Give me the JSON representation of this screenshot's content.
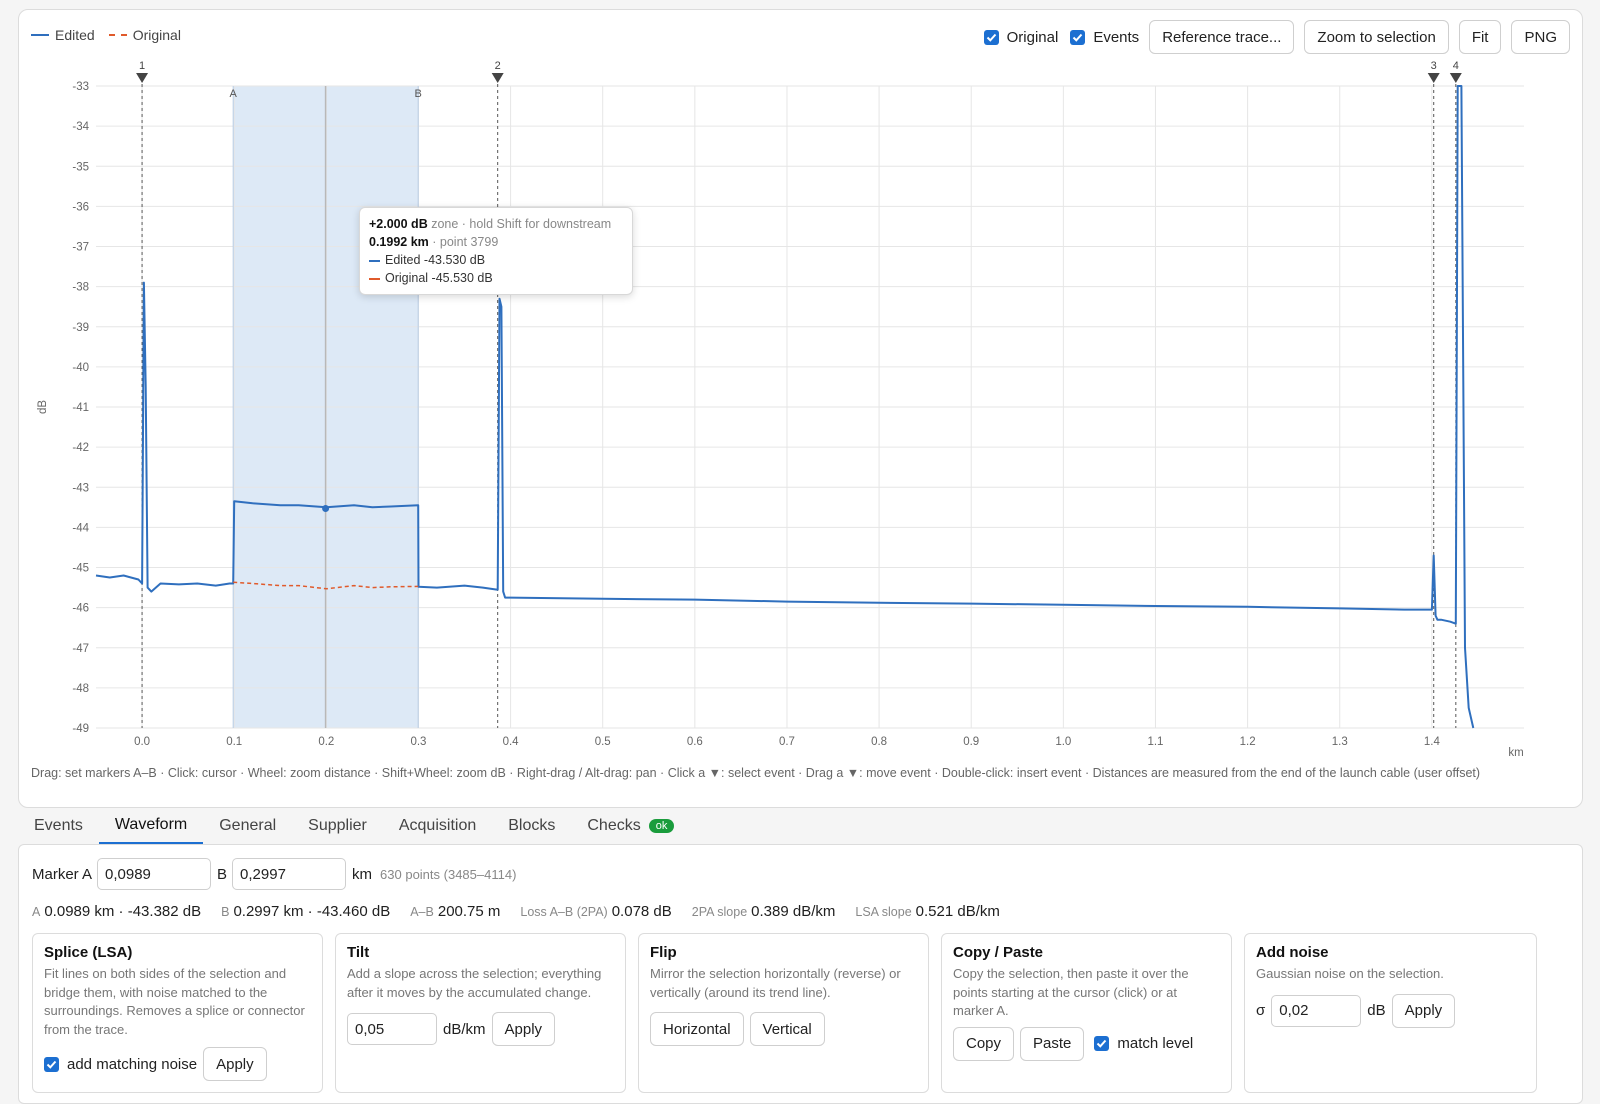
{
  "legend": {
    "edited": "Edited",
    "original": "Original"
  },
  "toolbar": {
    "original_label": "Original",
    "events_label": "Events",
    "reference_button": "Reference trace...",
    "zoom_button": "Zoom to selection",
    "fit_button": "Fit",
    "png_button": "PNG"
  },
  "colors": {
    "edited": "#2f6fbe",
    "original": "#e05a2b",
    "selection": "#dde9f6",
    "accent": "#1c6fd1",
    "ok": "#1a9c3c"
  },
  "chart_data": {
    "type": "line",
    "ylabel": "dB",
    "xunit": "km",
    "xlim": [
      -0.05,
      1.5
    ],
    "ylim": [
      -49,
      -33
    ],
    "xticks": [
      0.0,
      0.1,
      0.2,
      0.3,
      0.4,
      0.5,
      0.6,
      0.7,
      0.8,
      0.9,
      1.0,
      1.1,
      1.2,
      1.3,
      1.4
    ],
    "yticks": [
      -33,
      -34,
      -35,
      -36,
      -37,
      -38,
      -39,
      -40,
      -41,
      -42,
      -43,
      -44,
      -45,
      -46,
      -47,
      -48,
      -49
    ],
    "grid": true,
    "legend_position": "top-left",
    "series": [
      {
        "name": "Edited",
        "style": "solid",
        "x": [
          -0.05,
          -0.035,
          -0.02,
          -0.004,
          0.0,
          0.002,
          0.004,
          0.006,
          0.01,
          0.02,
          0.04,
          0.06,
          0.08,
          0.095,
          0.0989,
          0.1,
          0.12,
          0.15,
          0.17,
          0.2,
          0.23,
          0.25,
          0.27,
          0.2997,
          0.3,
          0.32,
          0.35,
          0.37,
          0.385,
          0.386,
          0.388,
          0.39,
          0.392,
          0.394,
          0.4,
          0.5,
          0.6,
          0.7,
          0.8,
          0.9,
          1.0,
          1.1,
          1.2,
          1.3,
          1.37,
          1.4,
          1.402,
          1.404,
          1.406,
          1.41,
          1.42,
          1.426,
          1.428,
          1.432,
          1.436,
          1.44,
          1.445
        ],
        "values": [
          -45.2,
          -45.25,
          -45.2,
          -45.3,
          -45.4,
          -37.9,
          -40.5,
          -45.5,
          -45.6,
          -45.4,
          -45.42,
          -45.4,
          -45.45,
          -45.4,
          -45.4,
          -43.35,
          -43.4,
          -43.45,
          -43.45,
          -43.5,
          -43.45,
          -43.5,
          -43.48,
          -43.45,
          -45.48,
          -45.5,
          -45.45,
          -45.5,
          -45.55,
          -45.55,
          -38.3,
          -38.5,
          -45.6,
          -45.75,
          -45.75,
          -45.78,
          -45.8,
          -45.85,
          -45.88,
          -45.9,
          -45.93,
          -45.96,
          -45.98,
          -46.02,
          -46.05,
          -46.05,
          -44.7,
          -46.2,
          -46.3,
          -46.3,
          -46.35,
          -46.4,
          -33.0,
          -33.0,
          -47.0,
          -48.5,
          -49.0
        ]
      },
      {
        "name": "Original",
        "style": "dashed",
        "x": [
          0.0989,
          0.12,
          0.15,
          0.17,
          0.2,
          0.23,
          0.25,
          0.27,
          0.2997
        ],
        "values": [
          -45.37,
          -45.4,
          -45.45,
          -45.45,
          -45.53,
          -45.45,
          -45.5,
          -45.48,
          -45.47
        ]
      }
    ],
    "events": [
      {
        "label": "1",
        "x": 0.0
      },
      {
        "label": "2",
        "x": 0.386
      },
      {
        "label": "3",
        "x": 1.402
      },
      {
        "label": "4",
        "x": 1.426
      }
    ],
    "selection": {
      "from": 0.0989,
      "to": 0.2997,
      "label_a": "A",
      "label_b": "B"
    },
    "cursor": {
      "x": 0.1992,
      "y": -43.53
    }
  },
  "tooltip": {
    "zone_value": "+2.000 dB",
    "zone_text": " zone · hold Shift for downstream",
    "distance": "0.1992 km",
    "point_text": " · point 3799",
    "edited_text": "Edited -43.530 dB",
    "original_text": "Original -45.530 dB"
  },
  "hint": "Drag: set markers A–B · Click: cursor · Wheel: zoom distance · Shift+Wheel: zoom dB · Right-drag / Alt-drag: pan · Click a ▼: select event · Drag a ▼: move event · Double-click: insert event · Distances are measured from the end of the launch cable (user offset)",
  "tabs": [
    {
      "label": "Events"
    },
    {
      "label": "Waveform"
    },
    {
      "label": "General"
    },
    {
      "label": "Supplier"
    },
    {
      "label": "Acquisition"
    },
    {
      "label": "Blocks"
    },
    {
      "label": "Checks",
      "badge": "ok"
    }
  ],
  "waveform": {
    "marker_a_label": "Marker A",
    "marker_a_value": "0,0989",
    "marker_b_label": "B",
    "marker_b_value": "0,2997",
    "unit_km": "km",
    "points_info": "630 points (3485–4114)",
    "stats": {
      "a_label": "A",
      "a_value": "0.0989 km · -43.382 dB",
      "b_label": "B",
      "b_value": "0.2997 km · -43.460 dB",
      "ab_label": "A–B",
      "ab_value": "200.75 m",
      "loss_label": "Loss A–B (2PA)",
      "loss_value": "0.078 dB",
      "slope2pa_label": "2PA slope",
      "slope2pa_value": "0.389 dB/km",
      "lsa_label": "LSA slope",
      "lsa_value": "0.521 dB/km"
    },
    "splice": {
      "title": "Splice (LSA)",
      "desc": "Fit lines on both sides of the selection and bridge them, with noise matched to the surroundings. Removes a splice or connector from the trace.",
      "noise_label": "add matching noise",
      "apply": "Apply"
    },
    "tilt": {
      "title": "Tilt",
      "desc": "Add a slope across the selection; everything after it moves by the accumulated change.",
      "value": "0,05",
      "unit": "dB/km",
      "apply": "Apply"
    },
    "flip": {
      "title": "Flip",
      "desc": "Mirror the selection horizontally (reverse) or vertically (around its trend line).",
      "horizontal": "Horizontal",
      "vertical": "Vertical"
    },
    "copypaste": {
      "title": "Copy / Paste",
      "desc": "Copy the selection, then paste it over the points starting at the cursor (click) or at marker A.",
      "copy": "Copy",
      "paste": "Paste",
      "match_label": "match level"
    },
    "noise": {
      "title": "Add noise",
      "desc": "Gaussian noise on the selection.",
      "sigma_label": "σ",
      "value": "0,02",
      "unit": "dB",
      "apply": "Apply"
    }
  }
}
